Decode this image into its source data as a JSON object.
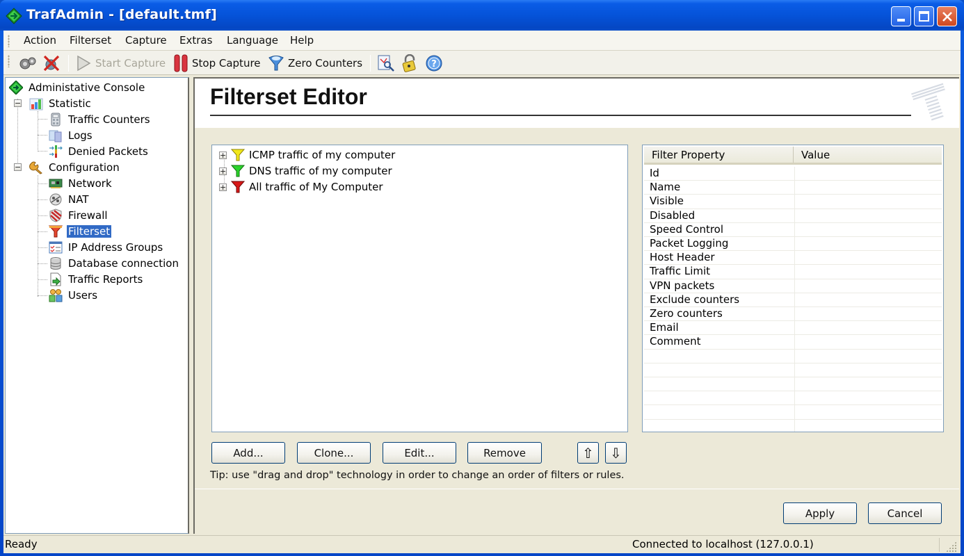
{
  "window": {
    "title": "TrafAdmin - [default.tmf]",
    "controls": {
      "minimize": "minimize",
      "maximize": "maximize",
      "close": "close"
    }
  },
  "menubar": {
    "items": [
      "Action",
      "Filterset",
      "Capture",
      "Extras",
      "Language",
      "Help"
    ]
  },
  "toolbar": {
    "settings_icon": "gears-icon",
    "disconnect_icon": "disconnect-icon",
    "start_capture": {
      "label": "Start Capture",
      "enabled": false
    },
    "stop_capture": {
      "label": "Stop Capture",
      "enabled": true
    },
    "zero_counters": {
      "label": "Zero Counters",
      "enabled": true
    },
    "extra_icons": [
      "report-search-icon",
      "lock-icon",
      "help-icon"
    ]
  },
  "navigation": {
    "root": {
      "label": "Administative Console",
      "icon": "console-diamond-icon"
    },
    "groups": [
      {
        "label": "Statistic",
        "icon": "bar-chart-icon",
        "expanded": true,
        "items": [
          {
            "label": "Traffic Counters",
            "icon": "calculator-icon"
          },
          {
            "label": "Logs",
            "icon": "logs-icon"
          },
          {
            "label": "Denied Packets",
            "icon": "denied-packets-icon"
          }
        ]
      },
      {
        "label": "Configuration",
        "icon": "wrench-icon",
        "expanded": true,
        "items": [
          {
            "label": "Network",
            "icon": "network-card-icon"
          },
          {
            "label": "NAT",
            "icon": "nat-icon"
          },
          {
            "label": "Firewall",
            "icon": "firewall-shield-icon"
          },
          {
            "label": "Filterset",
            "icon": "funnel-icon",
            "selected": true
          },
          {
            "label": "IP Address Groups",
            "icon": "checklist-icon"
          },
          {
            "label": "Database connection",
            "icon": "database-icon"
          },
          {
            "label": "Traffic Reports",
            "icon": "report-icon"
          },
          {
            "label": "Users",
            "icon": "users-icon"
          }
        ]
      }
    ]
  },
  "editor": {
    "title": "Filterset Editor",
    "filters": [
      {
        "label": "ICMP traffic of my computer",
        "color": "#f2e81a"
      },
      {
        "label": "DNS traffic of my computer",
        "color": "#2bd42b"
      },
      {
        "label": "All traffic of My Computer",
        "color": "#d81818"
      }
    ],
    "property_grid": {
      "columns": [
        "Filter Property",
        "Value"
      ],
      "rows": [
        {
          "property": "Id",
          "value": ""
        },
        {
          "property": "Name",
          "value": ""
        },
        {
          "property": "Visible",
          "value": ""
        },
        {
          "property": "Disabled",
          "value": ""
        },
        {
          "property": "Speed Control",
          "value": ""
        },
        {
          "property": "Packet Logging",
          "value": ""
        },
        {
          "property": "Host Header",
          "value": ""
        },
        {
          "property": "Traffic Limit",
          "value": ""
        },
        {
          "property": "VPN packets",
          "value": ""
        },
        {
          "property": "Exclude counters",
          "value": ""
        },
        {
          "property": "Zero counters",
          "value": ""
        },
        {
          "property": "Email",
          "value": ""
        },
        {
          "property": "Comment",
          "value": ""
        }
      ],
      "empty_rows": 6
    },
    "buttons": {
      "add": "Add...",
      "clone": "Clone...",
      "edit": "Edit...",
      "remove": "Remove",
      "move_up": "⇧",
      "move_down": "⇩"
    },
    "tip": "Tip: use \"drag and drop\" technology in order to change an order of filters or rules.",
    "apply": "Apply",
    "cancel": "Cancel"
  },
  "statusbar": {
    "left": "Ready",
    "right": "Connected to localhost (127.0.0.1)"
  }
}
